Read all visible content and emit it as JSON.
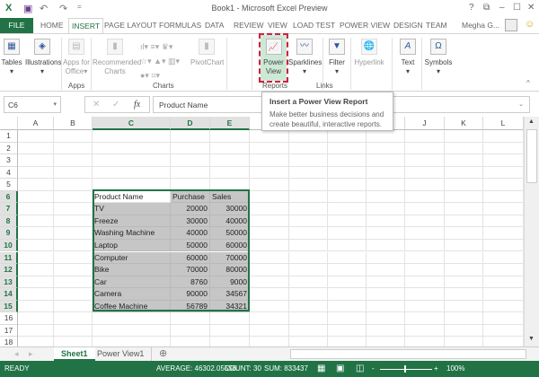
{
  "window": {
    "title": "Book1 - Microsoft Excel Preview",
    "help": "?",
    "restore": "⧉",
    "minimize": "–",
    "maximize": "☐",
    "close": "✕"
  },
  "quick_access": {
    "excel": "X",
    "save": "💾",
    "undo": "↶",
    "redo": "↷",
    "customize": "="
  },
  "tabs": [
    "HOME",
    "INSERT",
    "PAGE LAYOUT",
    "FORMULAS",
    "DATA",
    "REVIEW",
    "VIEW",
    "LOAD TEST",
    "POWER VIEW",
    "DESIGN",
    "TEAM"
  ],
  "file_tab": "FILE",
  "active_tab": "INSERT",
  "user": {
    "name": "Megha G...",
    "smiley": "☺"
  },
  "ribbon": {
    "buttons": [
      {
        "label": "Tables",
        "icon": "table-icon",
        "glyph": "▦",
        "sub": "▾"
      },
      {
        "label": "Illustrations",
        "icon": "illustrations-icon",
        "glyph": "◈",
        "sub": "▾"
      },
      {
        "label": "Apps for",
        "label2": "Office",
        "icon": "apps-icon",
        "glyph": "▤",
        "sub": "▾",
        "disabled": true
      },
      {
        "label": "Recommended",
        "label2": "Charts",
        "icon": "recommended-charts-icon",
        "glyph": "▮",
        "disabled": true
      },
      {
        "label": "PivotChart",
        "icon": "pivotchart-icon",
        "glyph": "▮",
        "disabled": true
      },
      {
        "label": "Power",
        "label2": "View",
        "icon": "power-view-icon",
        "glyph": "📈"
      },
      {
        "label": "Sparklines",
        "icon": "sparklines-icon",
        "glyph": "〰",
        "sub": "▾"
      },
      {
        "label": "Filter",
        "icon": "filter-icon",
        "glyph": "▼",
        "sub": "▾"
      },
      {
        "label": "Hyperlink",
        "icon": "hyperlink-icon",
        "glyph": "🌐",
        "disabled": true
      },
      {
        "label": "Text",
        "icon": "text-icon",
        "glyph": "A",
        "sub": "▾"
      },
      {
        "label": "Symbols",
        "icon": "symbols-icon",
        "glyph": "Ω",
        "sub": "▾"
      }
    ],
    "groups": [
      "Apps",
      "Charts",
      "Reports",
      "Links"
    ],
    "collapse": "^"
  },
  "tooltip": {
    "title": "Insert a Power View Report",
    "body": "Make better business decisions and create beautiful, interactive reports."
  },
  "formula_bar": {
    "name_box": "C6",
    "cancel": "✕",
    "enter": "✓",
    "fx": "fx",
    "value": "Product Name"
  },
  "columns": [
    "A",
    "B",
    "C",
    "D",
    "E",
    "F",
    "G",
    "H",
    "I",
    "J",
    "K",
    "L"
  ],
  "rows": [
    "1",
    "2",
    "3",
    "4",
    "5",
    "6",
    "7",
    "8",
    "9",
    "10",
    "11",
    "12",
    "13",
    "14",
    "15",
    "16",
    "17",
    "18"
  ],
  "table": {
    "header": [
      "Product Name",
      "Purchase",
      "Sales"
    ],
    "rows": [
      [
        "TV",
        "20000",
        "30000"
      ],
      [
        "Freeze",
        "30000",
        "40000"
      ],
      [
        "Washing Machine",
        "40000",
        "50000"
      ],
      [
        "Laptop",
        "50000",
        "60000"
      ],
      [
        "Computer",
        "60000",
        "70000"
      ],
      [
        "Bike",
        "70000",
        "80000"
      ],
      [
        "Car",
        "8760",
        "9000"
      ],
      [
        "Camera",
        "90000",
        "34567"
      ],
      [
        "Coffee Machine",
        "56789",
        "34321"
      ]
    ]
  },
  "sheets": [
    "Sheet1",
    "Power View1"
  ],
  "active_sheet": "Sheet1",
  "status": {
    "ready": "READY",
    "average": "AVERAGE: 46302.05556",
    "count": "COUNT: 30",
    "sum": "SUM: 833437",
    "zoom": "100%",
    "zoom_level_percent": 100
  },
  "colors": {
    "accent": "#217346",
    "selection": "#c6c6c6",
    "power_view_highlight": "#cde9d6"
  }
}
